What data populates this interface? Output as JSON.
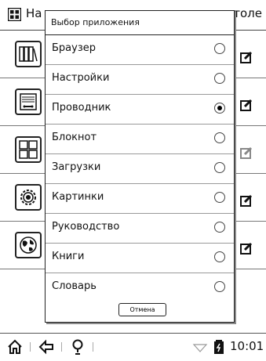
{
  "header": {
    "title_left": "На",
    "title_right": "столе"
  },
  "dialog": {
    "title": "Выбор приложения",
    "options": [
      {
        "label": "Браузер",
        "selected": false
      },
      {
        "label": "Настройки",
        "selected": false
      },
      {
        "label": "Проводник",
        "selected": true
      },
      {
        "label": "Блокнот",
        "selected": false
      },
      {
        "label": "Загрузки",
        "selected": false
      },
      {
        "label": "Картинки",
        "selected": false
      },
      {
        "label": "Руководство",
        "selected": false
      },
      {
        "label": "Книги",
        "selected": false
      },
      {
        "label": "Словарь",
        "selected": false
      }
    ],
    "cancel_label": "Отмена"
  },
  "statusbar": {
    "time": "10:01"
  },
  "icons": [
    "apps-grid-icon",
    "bookshelf-icon",
    "disk-drive-icon",
    "grid-apps-icon",
    "gear-icon",
    "globe-icon",
    "edit-icon",
    "home-icon",
    "back-icon",
    "bulb-icon",
    "wifi-icon",
    "battery-icon"
  ]
}
